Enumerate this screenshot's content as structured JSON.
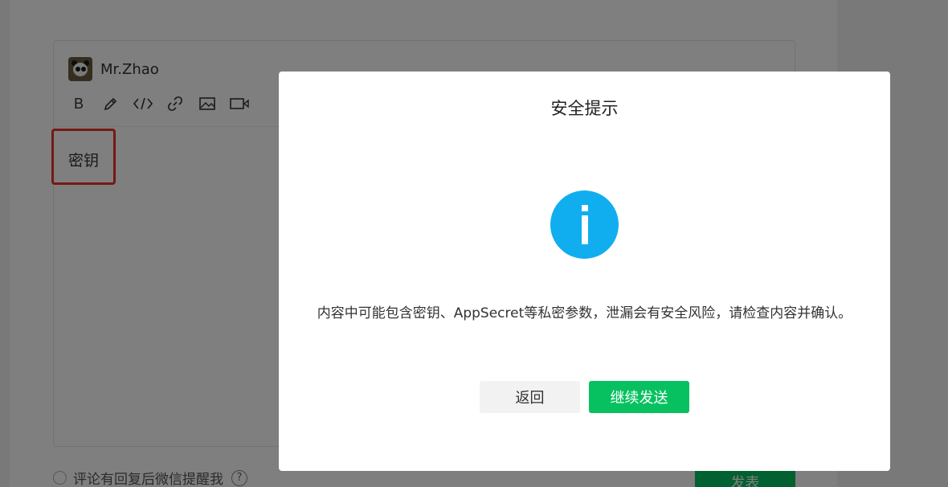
{
  "editor": {
    "author_name": "Mr.Zhao",
    "content": "密钥",
    "toolbar": {
      "bold_label": "B",
      "icons": [
        "bold-icon",
        "highlight-pen-icon",
        "code-icon",
        "link-icon",
        "image-icon",
        "video-icon"
      ]
    }
  },
  "footer": {
    "remind_label": "评论有回复后微信提醒我",
    "help_label": "?",
    "publish_label": "发表"
  },
  "dialog": {
    "title": "安全提示",
    "icon": "info-icon",
    "message": "内容中可能包含密钥、AppSecret等私密参数，泄漏会有安全风险，请检查内容并确认。",
    "back_label": "返回",
    "continue_label": "继续发送"
  },
  "colors": {
    "accent_green": "#07c160",
    "info_blue": "#10aeef",
    "highlight_red": "#e8352a"
  }
}
